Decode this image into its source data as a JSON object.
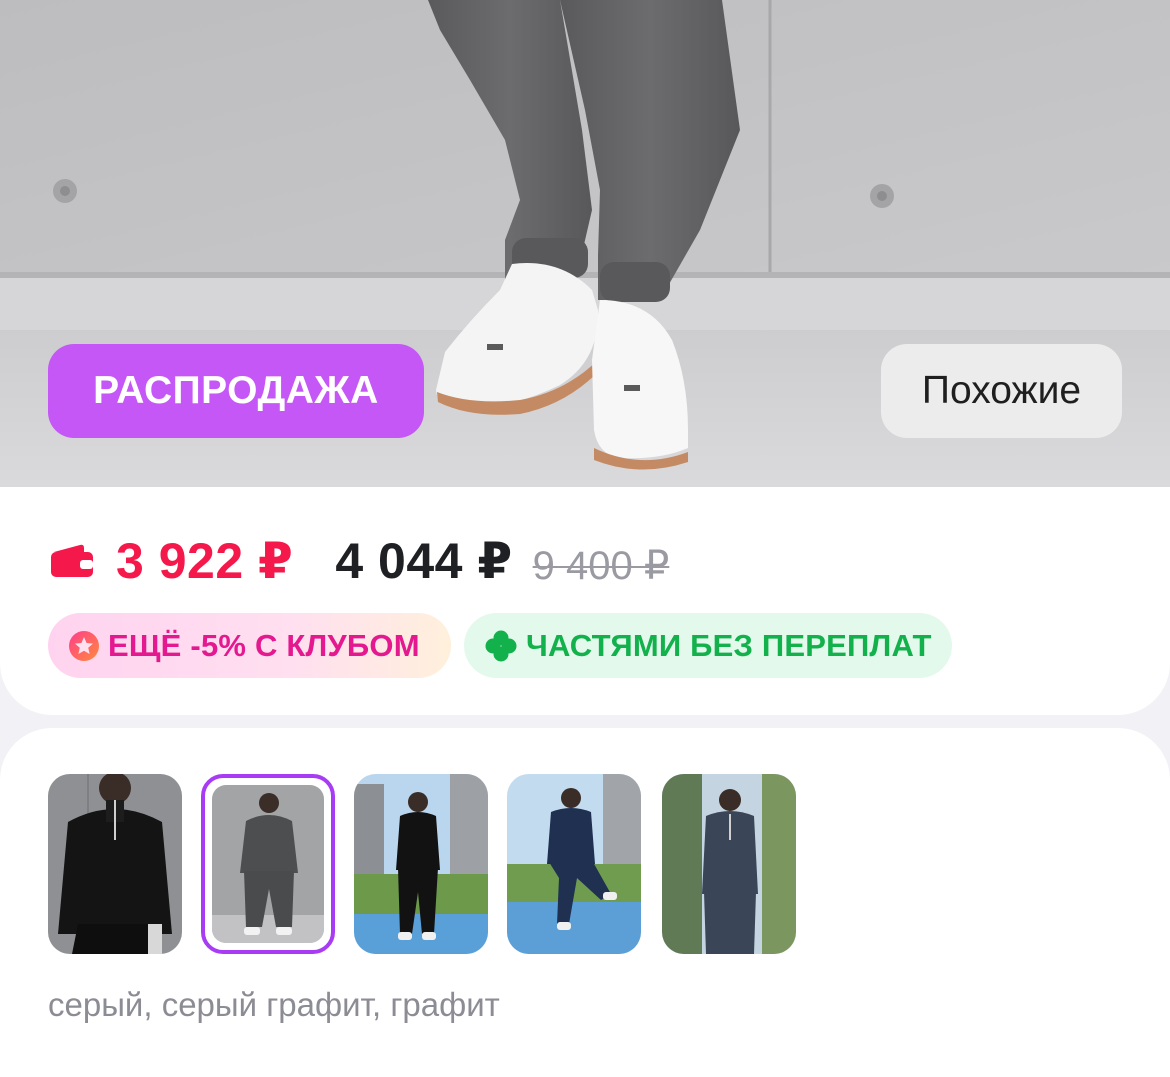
{
  "hero": {
    "sale_badge": "РАСПРОДАЖА",
    "similar_button": "Похожие"
  },
  "price": {
    "wallet_price": "3 922 ₽",
    "current_price": "4 044 ₽",
    "old_price": "9 400 ₽"
  },
  "chips": {
    "club": "ЕЩЁ -5% С КЛУБОМ",
    "installments": "ЧАСТЯМИ БЕЗ ПЕРЕПЛАТ"
  },
  "variants": {
    "items": [
      {
        "name": "black tracksuit"
      },
      {
        "name": "graphite tracksuit",
        "selected": true
      },
      {
        "name": "black tracksuit outdoor"
      },
      {
        "name": "navy tracksuit outdoor"
      },
      {
        "name": "blue-grey tracksuit outdoor"
      }
    ],
    "color_caption": "серый, серый графит, графит"
  },
  "colors": {
    "sale": "#c457f5",
    "wallet_price": "#f5184b",
    "club": "#e4198f",
    "installments": "#12b14b",
    "selected_border": "#a83cf5"
  }
}
